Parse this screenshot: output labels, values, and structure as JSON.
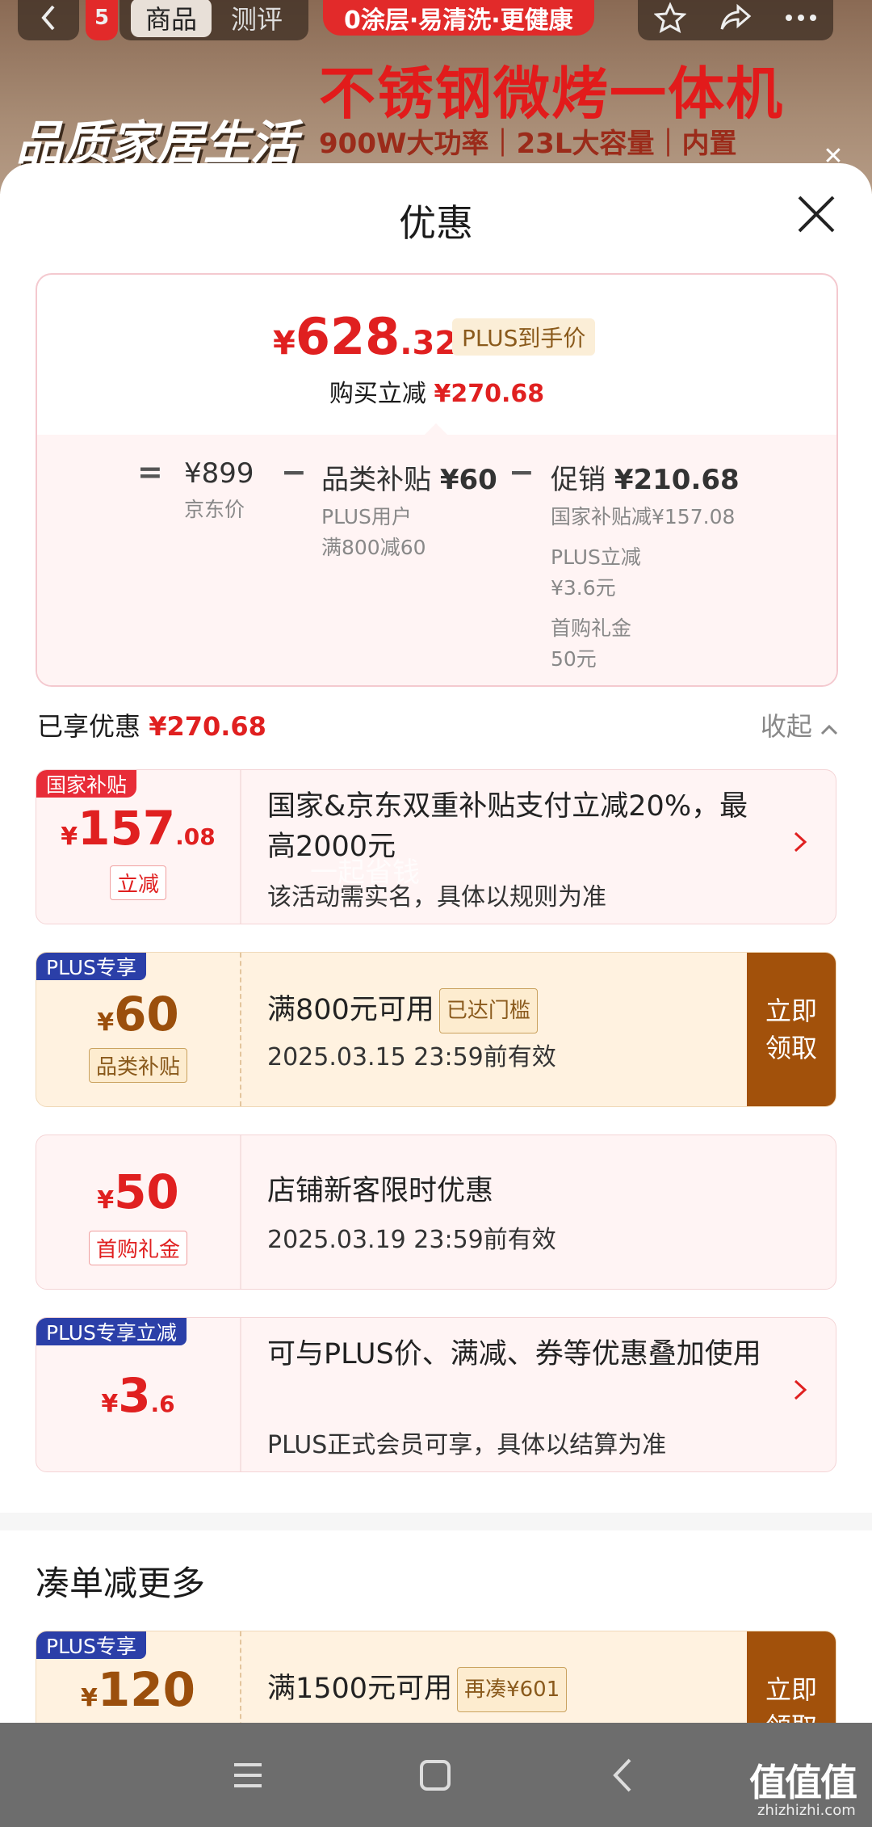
{
  "header": {
    "back_icon": "chevron-left-icon",
    "tabs": [
      {
        "label": "商品"
      },
      {
        "label": "测评"
      }
    ],
    "left_badge": "5",
    "promo_pill": "0涂层·易清洗·更健康",
    "product_headline": "不锈钢微烤一体机",
    "spec_line": "900W大功率｜23L大容量｜内置",
    "quality_text": "品质家居生活"
  },
  "sheet": {
    "title": "优惠",
    "close_icon": "close-icon"
  },
  "price_card": {
    "currency": "¥",
    "price_int": "628",
    "price_dec": ".32",
    "plus_badge": "PLUS到手价",
    "reduce_label": "购买立减",
    "reduce_amount": "¥270.68",
    "eq": "=",
    "minus": "−",
    "jd_price": "¥899",
    "jd_label": "京东价",
    "category_title": "品类补贴",
    "category_amount": "¥60",
    "category_sub1": "PLUS用户",
    "category_sub2": "满800减60",
    "promo_title": "促销",
    "promo_amount": "¥210.68",
    "promo_sub1": "国家补贴减¥157.08",
    "promo_sub2": "PLUS立减",
    "promo_sub3": "¥3.6元",
    "promo_sub4": "首购礼金",
    "promo_sub5": "50元"
  },
  "enjoyed": {
    "label": "已享优惠",
    "amount": "¥270.68",
    "collapse_label": "收起"
  },
  "coupons": [
    {
      "tag": "国家补贴",
      "yen": "¥",
      "int": "157",
      "dec": ".08",
      "label": "立减",
      "text": "国家&京东双重补贴支付立减20%，最高2000元",
      "sub": "该活动需实名，具体以规则为准"
    },
    {
      "tag": "PLUS专享",
      "yen": "¥",
      "int": "60",
      "label": "品类补贴",
      "text": "满800元可用",
      "badge": "已达门槛",
      "sub": "2025.03.15 23:59前有效",
      "claim": "立即领取"
    },
    {
      "yen": "¥",
      "int": "50",
      "label": "首购礼金",
      "text": "店铺新客限时优惠",
      "sub": "2025.03.19 23:59前有效"
    },
    {
      "tag": "PLUS专享立减",
      "yen": "¥",
      "int": "3",
      "dec": ".6",
      "text": "可与PLUS价、满减、券等优惠叠加使用",
      "sub": "PLUS正式会员可享，具体以结算为准"
    },
    {
      "tag": "PLUS专享",
      "yen": "¥",
      "int": "120",
      "text": "满1500元可用",
      "badge": "再凑¥601",
      "claim": "立即领取"
    }
  ],
  "more_section_title": "凑单减更多",
  "watermark": "一起省钱",
  "navbar": {
    "menu_icon": "menu-icon",
    "home_icon": "home-square-icon",
    "back_icon": "back-arrow-icon",
    "logo": "值值值",
    "logo_url": "zhizhizhi.com"
  },
  "colors": {
    "accent_red": "#e02020",
    "plus_blue": "#2b3fa8",
    "claim_brown": "#a2510b"
  }
}
